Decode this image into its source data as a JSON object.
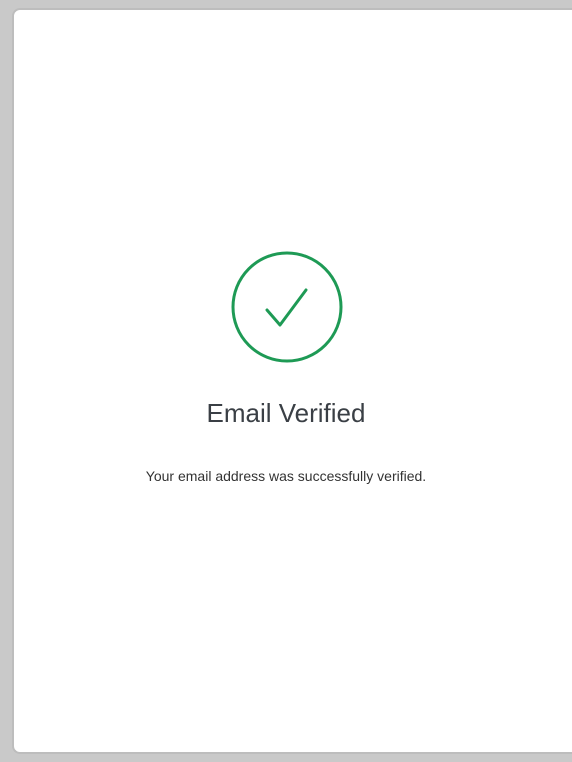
{
  "status": {
    "icon": "check-circle-icon",
    "color": "#1e9a55",
    "title": "Email Verified",
    "message": "Your email address was successfully verified."
  }
}
